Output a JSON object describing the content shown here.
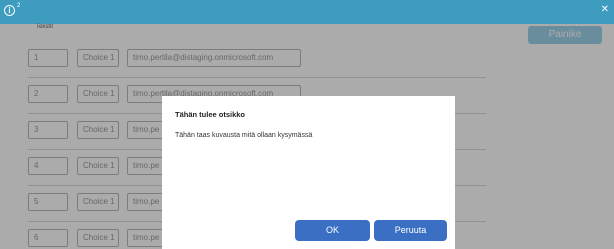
{
  "topbar": {
    "info_superscript": "2"
  },
  "header": {
    "column_label": "Tekstit",
    "button_label": "Painike"
  },
  "rows": [
    {
      "num": "1",
      "choice": "Choice 1",
      "email": "timo.pertila@distaging.onmicrosoft.com"
    },
    {
      "num": "2",
      "choice": "Choice 1",
      "email": "timo.pertila@distaging.onmicrosoft.com"
    },
    {
      "num": "3",
      "choice": "Choice 1",
      "email": "timo.pe"
    },
    {
      "num": "4",
      "choice": "Choice 1",
      "email": "timo.pe"
    },
    {
      "num": "5",
      "choice": "Choice 1",
      "email": "timo.pe"
    },
    {
      "num": "6",
      "choice": "Choice 1",
      "email": "timo.pe"
    }
  ],
  "dialog": {
    "title": "Tähän tulee otsikko",
    "body": "Tähän taas kuvausta mitä ollaan kysymässä",
    "ok_label": "OK",
    "cancel_label": "Peruuta"
  },
  "colors": {
    "topbar": "#3d9cc0",
    "button": "#3a6fc4",
    "painike": "#9fd3ea"
  }
}
